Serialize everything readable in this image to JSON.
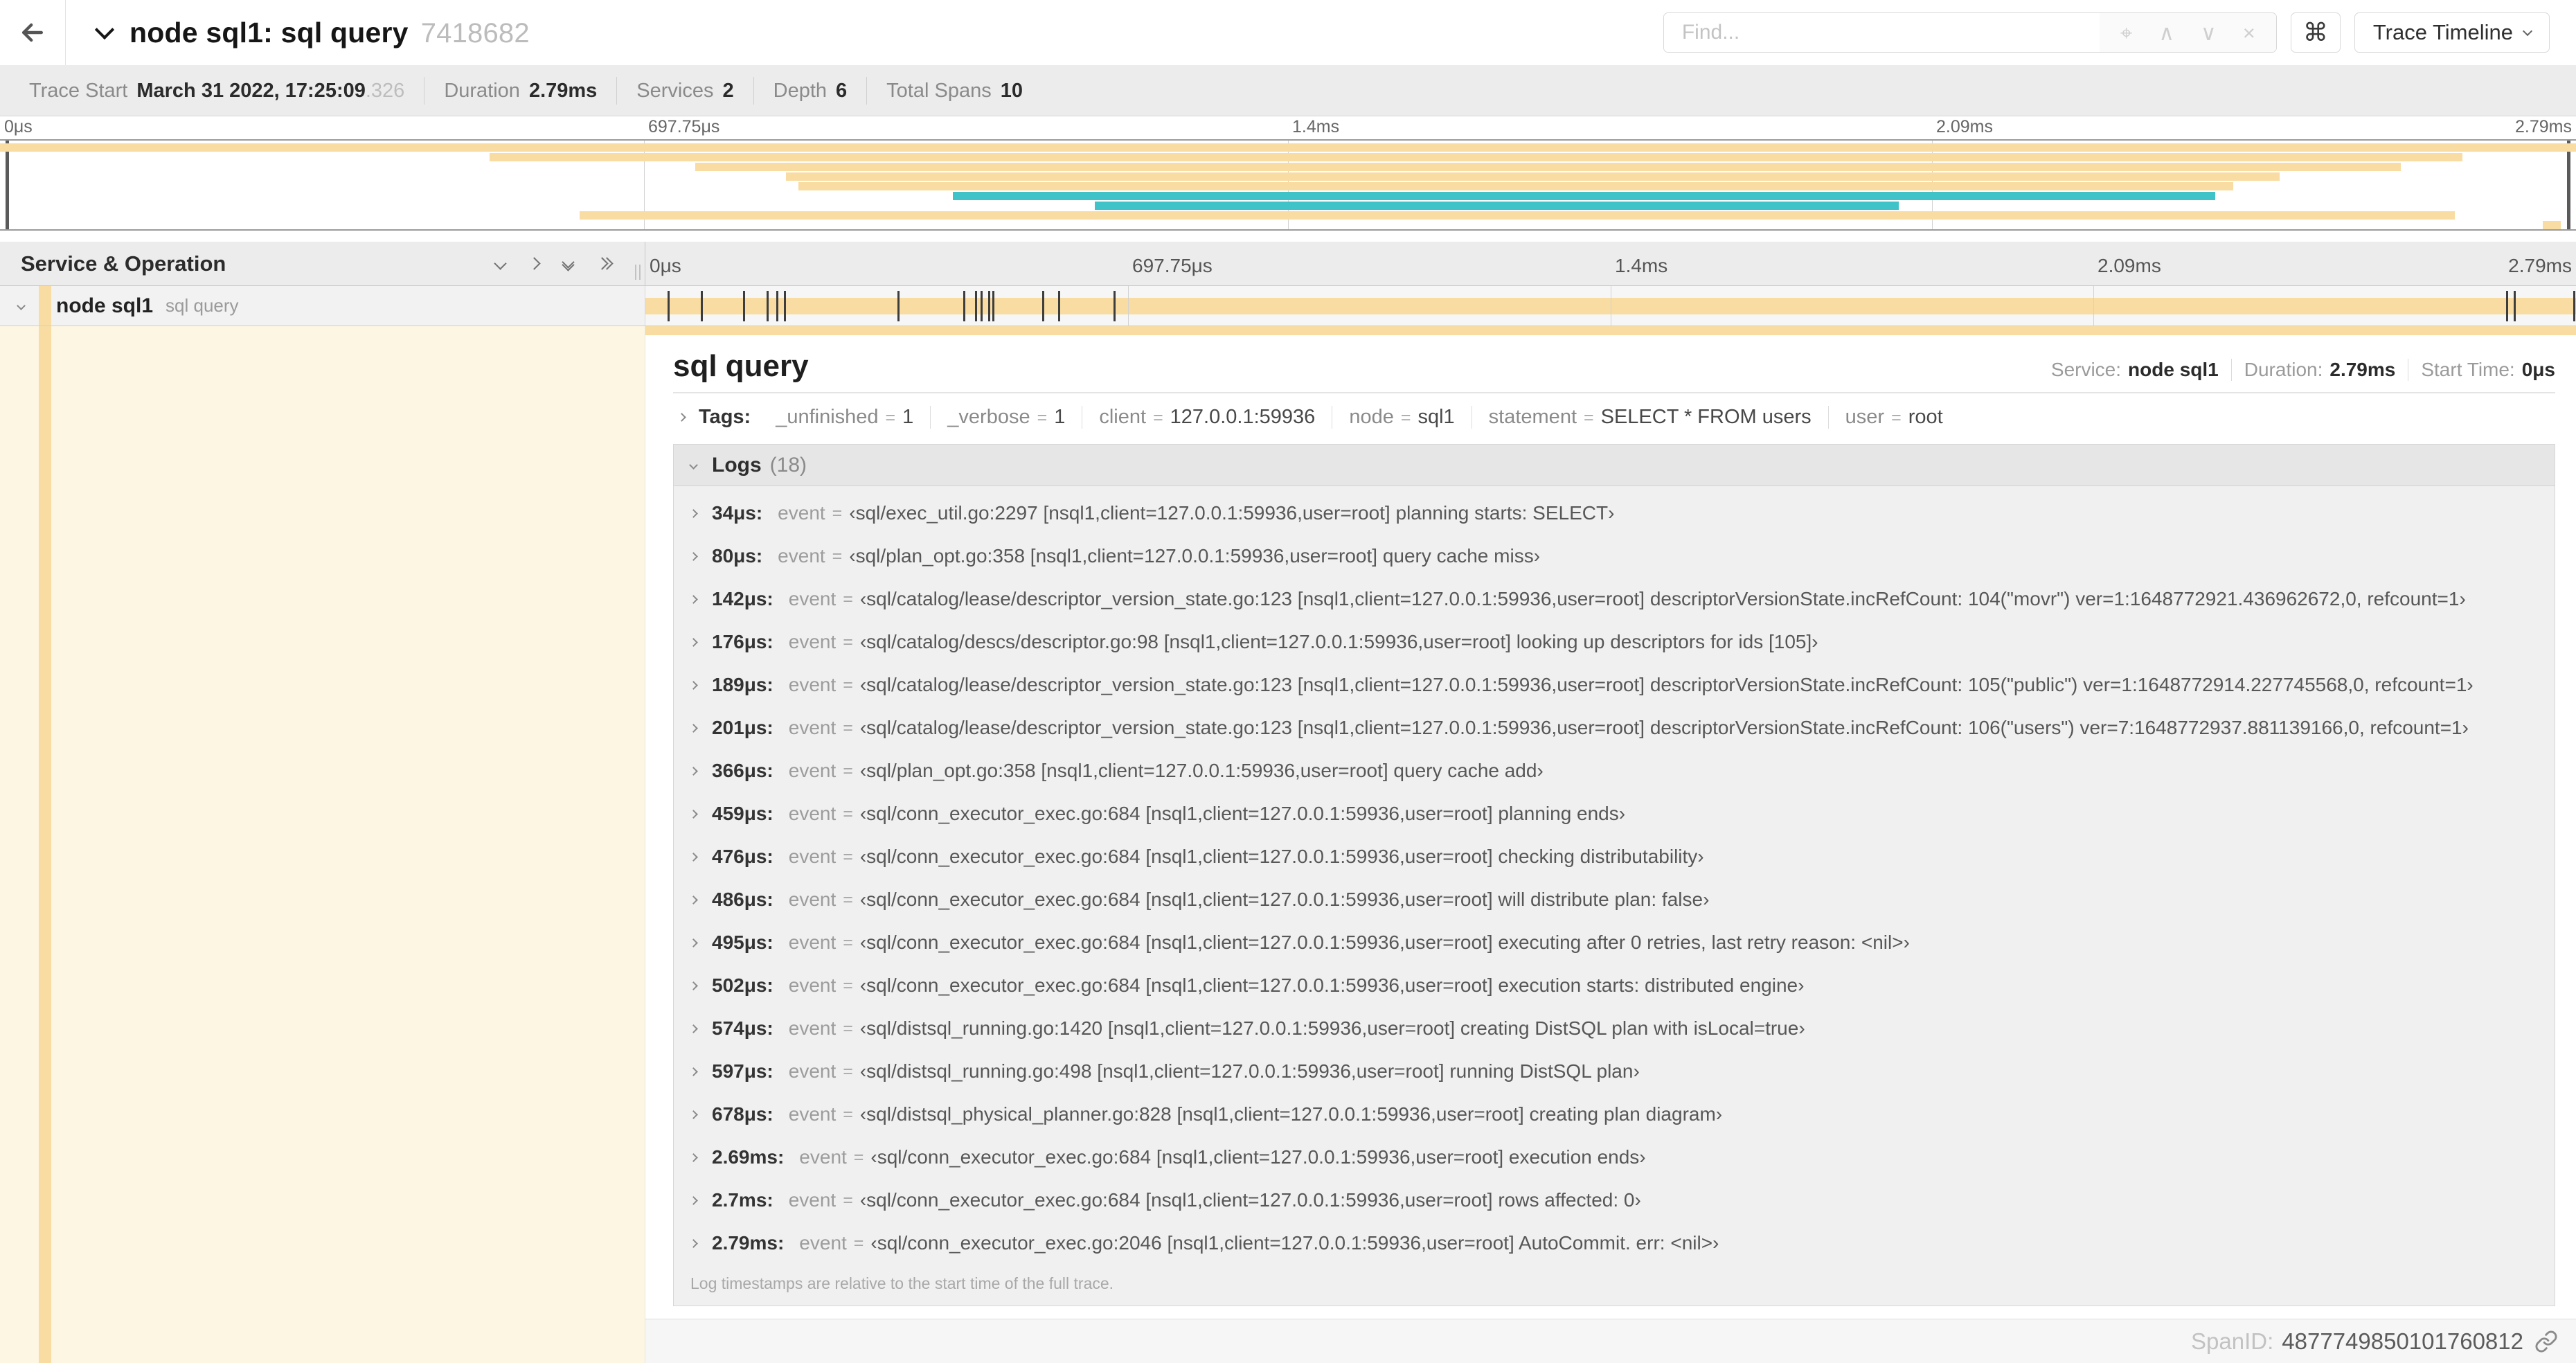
{
  "header": {
    "title": "node sql1: sql query",
    "trace_id": "7418682",
    "find_placeholder": "Find...",
    "shortcut_button_label": "⌘",
    "view_selector_label": "Trace Timeline",
    "find_icons": {
      "locate": "⌖",
      "prev": "∧",
      "next": "∨",
      "clear": "×"
    }
  },
  "summary": {
    "items": [
      {
        "label": "Trace Start",
        "value": "March 31 2022, 17:25:09",
        "suffix": ".326"
      },
      {
        "label": "Duration",
        "value": "2.79ms"
      },
      {
        "label": "Services",
        "value": "2"
      },
      {
        "label": "Depth",
        "value": "6"
      },
      {
        "label": "Total Spans",
        "value": "10"
      }
    ]
  },
  "timeline": {
    "ticks": [
      {
        "label": "0μs",
        "pct": 0
      },
      {
        "label": "697.75μs",
        "pct": 25
      },
      {
        "label": "1.4ms",
        "pct": 50
      },
      {
        "label": "2.09ms",
        "pct": 75
      },
      {
        "label": "2.79ms",
        "pct": 100
      }
    ],
    "colors": {
      "tan": "#F8DCA1",
      "teal": "#3FC3C8",
      "cream": "#FDF6E2"
    },
    "minimap_spans": [
      {
        "start": 0,
        "end": 100,
        "color": "tan"
      },
      {
        "start": 19,
        "end": 95.6,
        "color": "tan"
      },
      {
        "start": 27,
        "end": 93.2,
        "color": "tan"
      },
      {
        "start": 30.5,
        "end": 88.5,
        "color": "tan"
      },
      {
        "start": 31,
        "end": 86.7,
        "color": "tan"
      },
      {
        "start": 37,
        "end": 86,
        "color": "teal"
      },
      {
        "start": 42.5,
        "end": 73.7,
        "color": "teal"
      },
      {
        "start": 22.5,
        "end": 95.3,
        "color": "tan"
      },
      {
        "start": 98.7,
        "end": 99.4,
        "color": "tan"
      }
    ],
    "log_marker_pcts": [
      1.2,
      2.9,
      5.1,
      6.3,
      6.8,
      7.2,
      13.1,
      16.5,
      17.1,
      17.4,
      17.8,
      18.0,
      20.6,
      21.4,
      24.3,
      96.4,
      96.8,
      99.9
    ]
  },
  "grid": {
    "left_header": "Service & Operation",
    "row": {
      "service": "node sql1",
      "operation": "sql query"
    }
  },
  "detail": {
    "title": "sql query",
    "meta": [
      {
        "label": "Service:",
        "value": "node sql1"
      },
      {
        "label": "Duration:",
        "value": "2.79ms"
      },
      {
        "label": "Start Time:",
        "value": "0μs"
      }
    ],
    "tags_label": "Tags:",
    "kv_separator": "=",
    "tags": [
      {
        "key": "_unfinished",
        "value": "1"
      },
      {
        "key": "_verbose",
        "value": "1"
      },
      {
        "key": "client",
        "value": "127.0.0.1:59936"
      },
      {
        "key": "node",
        "value": "sql1"
      },
      {
        "key": "statement",
        "value": "SELECT * FROM users"
      },
      {
        "key": "user",
        "value": "root"
      }
    ],
    "logs_label": "Logs",
    "logs_count": "(18)",
    "logs": [
      {
        "time": "34μs:",
        "key": "event",
        "value": "‹sql/exec_util.go:2297 [nsql1,client=127.0.0.1:59936,user=root] planning starts: SELECT›"
      },
      {
        "time": "80μs:",
        "key": "event",
        "value": "‹sql/plan_opt.go:358 [nsql1,client=127.0.0.1:59936,user=root] query cache miss›"
      },
      {
        "time": "142μs:",
        "key": "event",
        "value": "‹sql/catalog/lease/descriptor_version_state.go:123 [nsql1,client=127.0.0.1:59936,user=root] descriptorVersionState.incRefCount: 104(\"movr\") ver=1:1648772921.436962672,0, refcount=1›"
      },
      {
        "time": "176μs:",
        "key": "event",
        "value": "‹sql/catalog/descs/descriptor.go:98 [nsql1,client=127.0.0.1:59936,user=root] looking up descriptors for ids [105]›"
      },
      {
        "time": "189μs:",
        "key": "event",
        "value": "‹sql/catalog/lease/descriptor_version_state.go:123 [nsql1,client=127.0.0.1:59936,user=root] descriptorVersionState.incRefCount: 105(\"public\") ver=1:1648772914.227745568,0, refcount=1›"
      },
      {
        "time": "201μs:",
        "key": "event",
        "value": "‹sql/catalog/lease/descriptor_version_state.go:123 [nsql1,client=127.0.0.1:59936,user=root] descriptorVersionState.incRefCount: 106(\"users\") ver=7:1648772937.881139166,0, refcount=1›"
      },
      {
        "time": "366μs:",
        "key": "event",
        "value": "‹sql/plan_opt.go:358 [nsql1,client=127.0.0.1:59936,user=root] query cache add›"
      },
      {
        "time": "459μs:",
        "key": "event",
        "value": "‹sql/conn_executor_exec.go:684 [nsql1,client=127.0.0.1:59936,user=root] planning ends›"
      },
      {
        "time": "476μs:",
        "key": "event",
        "value": "‹sql/conn_executor_exec.go:684 [nsql1,client=127.0.0.1:59936,user=root] checking distributability›"
      },
      {
        "time": "486μs:",
        "key": "event",
        "value": "‹sql/conn_executor_exec.go:684 [nsql1,client=127.0.0.1:59936,user=root] will distribute plan: false›"
      },
      {
        "time": "495μs:",
        "key": "event",
        "value": "‹sql/conn_executor_exec.go:684 [nsql1,client=127.0.0.1:59936,user=root] executing after 0 retries, last retry reason: <nil>›"
      },
      {
        "time": "502μs:",
        "key": "event",
        "value": "‹sql/conn_executor_exec.go:684 [nsql1,client=127.0.0.1:59936,user=root] execution starts: distributed engine›"
      },
      {
        "time": "574μs:",
        "key": "event",
        "value": "‹sql/distsql_running.go:1420 [nsql1,client=127.0.0.1:59936,user=root] creating DistSQL plan with isLocal=true›"
      },
      {
        "time": "597μs:",
        "key": "event",
        "value": "‹sql/distsql_running.go:498 [nsql1,client=127.0.0.1:59936,user=root] running DistSQL plan›"
      },
      {
        "time": "678μs:",
        "key": "event",
        "value": "‹sql/distsql_physical_planner.go:828 [nsql1,client=127.0.0.1:59936,user=root] creating plan diagram›"
      },
      {
        "time": "2.69ms:",
        "key": "event",
        "value": "‹sql/conn_executor_exec.go:684 [nsql1,client=127.0.0.1:59936,user=root] execution ends›"
      },
      {
        "time": "2.7ms:",
        "key": "event",
        "value": "‹sql/conn_executor_exec.go:684 [nsql1,client=127.0.0.1:59936,user=root] rows affected: 0›"
      },
      {
        "time": "2.79ms:",
        "key": "event",
        "value": "‹sql/conn_executor_exec.go:2046 [nsql1,client=127.0.0.1:59936,user=root] AutoCommit. err: <nil>›"
      }
    ],
    "logs_note": "Log timestamps are relative to the start time of the full trace.",
    "span_id_label": "SpanID:",
    "span_id": "4877749850101760812"
  }
}
